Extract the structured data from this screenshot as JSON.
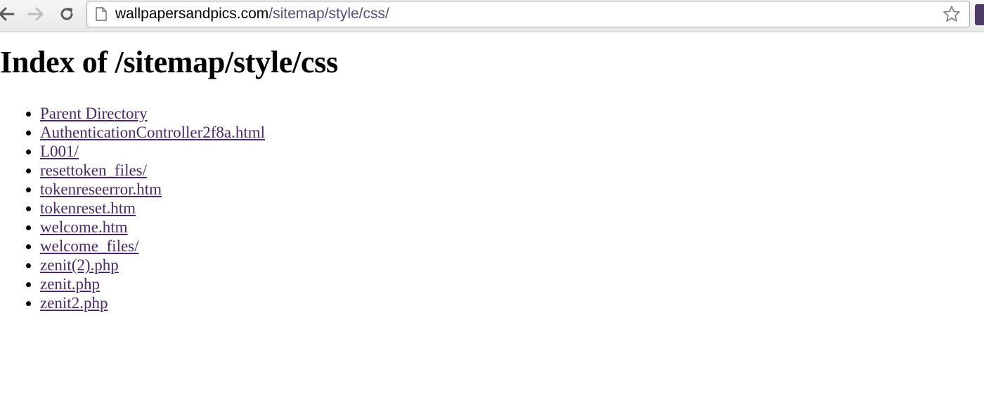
{
  "browser": {
    "url_host": "wallpapersandpics.com",
    "url_path": "/sitemap/style/css/",
    "icons": {
      "back": "back-arrow-icon",
      "forward": "forward-arrow-icon",
      "reload": "reload-icon",
      "page": "page-icon",
      "bookmark": "star-icon",
      "extension": "extension-icon"
    }
  },
  "page": {
    "title": "Index of /sitemap/style/css",
    "entries": [
      "Parent Directory",
      "AuthenticationController2f8a.html",
      "L001/",
      "resettoken_files/",
      "tokenreseerror.htm",
      "tokenreset.htm",
      "welcome.htm",
      "welcome_files/",
      "zenit(2).php",
      "zenit.php",
      "zenit2.php"
    ]
  },
  "colors": {
    "link": "#4a2a68",
    "url_path": "#5b4b78"
  }
}
